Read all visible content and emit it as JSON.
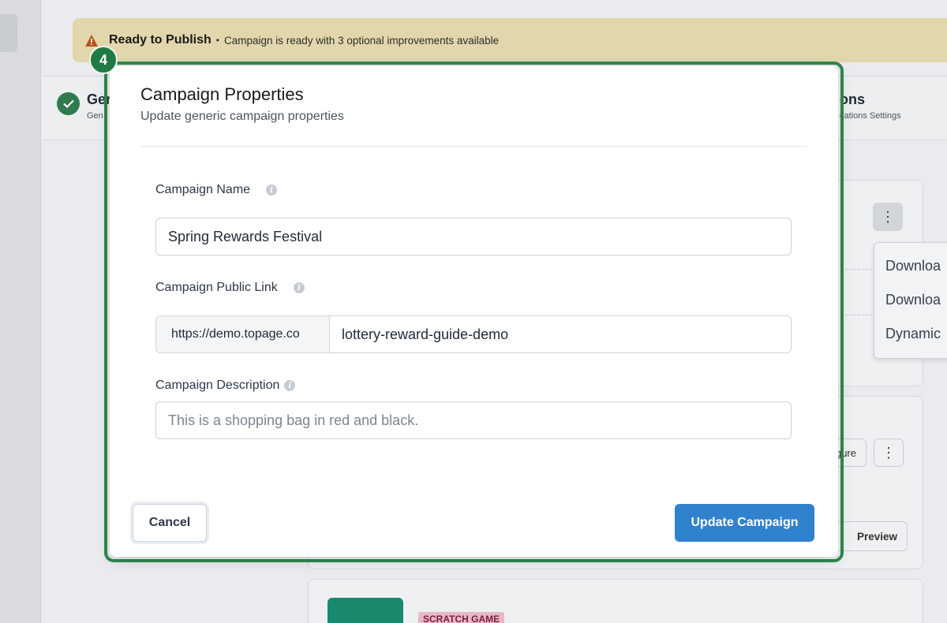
{
  "banner": {
    "title": "Ready to Publish",
    "separator": "•",
    "text": "Campaign is ready with 3 optional improvements available"
  },
  "steps": {
    "left_title": "Ger",
    "left_sub": "Gen",
    "right_title": "ons",
    "right_sub": "cations Settings"
  },
  "background_cards": {
    "dropdown_items": [
      "Downloa",
      "Downloa",
      "Dynamic"
    ],
    "configure_label": "gure",
    "preview_label": "Preview",
    "scratch_badge": "SCRATCH GAME"
  },
  "tour": {
    "step_number": "4",
    "highlight_color": "#2f8a4e"
  },
  "modal": {
    "title": "Campaign Properties",
    "subtitle": "Update generic campaign properties",
    "campaign_name": {
      "label": "Campaign Name",
      "value": "Spring Rewards Festival"
    },
    "public_link": {
      "label": "Campaign Public Link",
      "prefix": "https://demo.topage.co",
      "slug": "lottery-reward-guide-demo"
    },
    "description": {
      "label": "Campaign Description",
      "placeholder": "This is a shopping bag in red and black."
    },
    "cancel_label": "Cancel",
    "update_label": "Update Campaign",
    "accent_color": "#3182ce"
  }
}
